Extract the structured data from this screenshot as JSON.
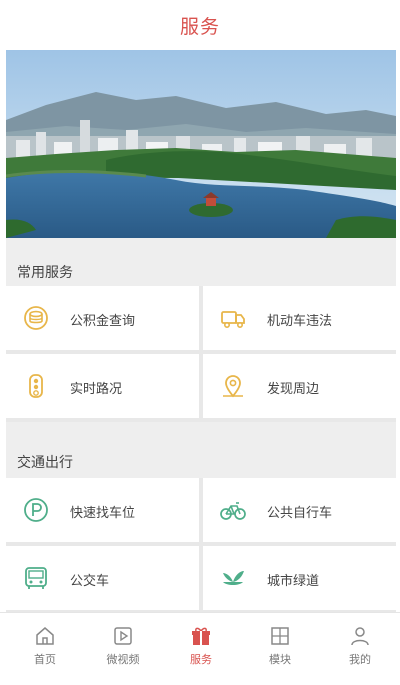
{
  "header": {
    "title": "服务"
  },
  "sections": [
    {
      "title": "常用服务",
      "items": [
        {
          "label": "公积金查询",
          "icon": "coin-stack-icon"
        },
        {
          "label": "机动车违法",
          "icon": "truck-icon"
        },
        {
          "label": "实时路况",
          "icon": "traffic-light-icon"
        },
        {
          "label": "发现周边",
          "icon": "map-pin-icon"
        }
      ]
    },
    {
      "title": "交通出行",
      "items": [
        {
          "label": "快速找车位",
          "icon": "parking-icon"
        },
        {
          "label": "公共自行车",
          "icon": "bicycle-icon"
        },
        {
          "label": "公交车",
          "icon": "bus-icon"
        },
        {
          "label": "城市绿道",
          "icon": "leaf-icon"
        }
      ]
    }
  ],
  "tabbar": {
    "items": [
      {
        "label": "首页",
        "icon": "home-icon",
        "active": false
      },
      {
        "label": "微视频",
        "icon": "video-icon",
        "active": false
      },
      {
        "label": "服务",
        "icon": "gift-icon",
        "active": true
      },
      {
        "label": "模块",
        "icon": "module-icon",
        "active": false
      },
      {
        "label": "我的",
        "icon": "person-icon",
        "active": false
      }
    ]
  },
  "colors": {
    "accent": "#d9534f",
    "icon_yellow": "#e8b64a",
    "icon_green": "#4fae8a",
    "section_bg": "#eeeeee"
  }
}
